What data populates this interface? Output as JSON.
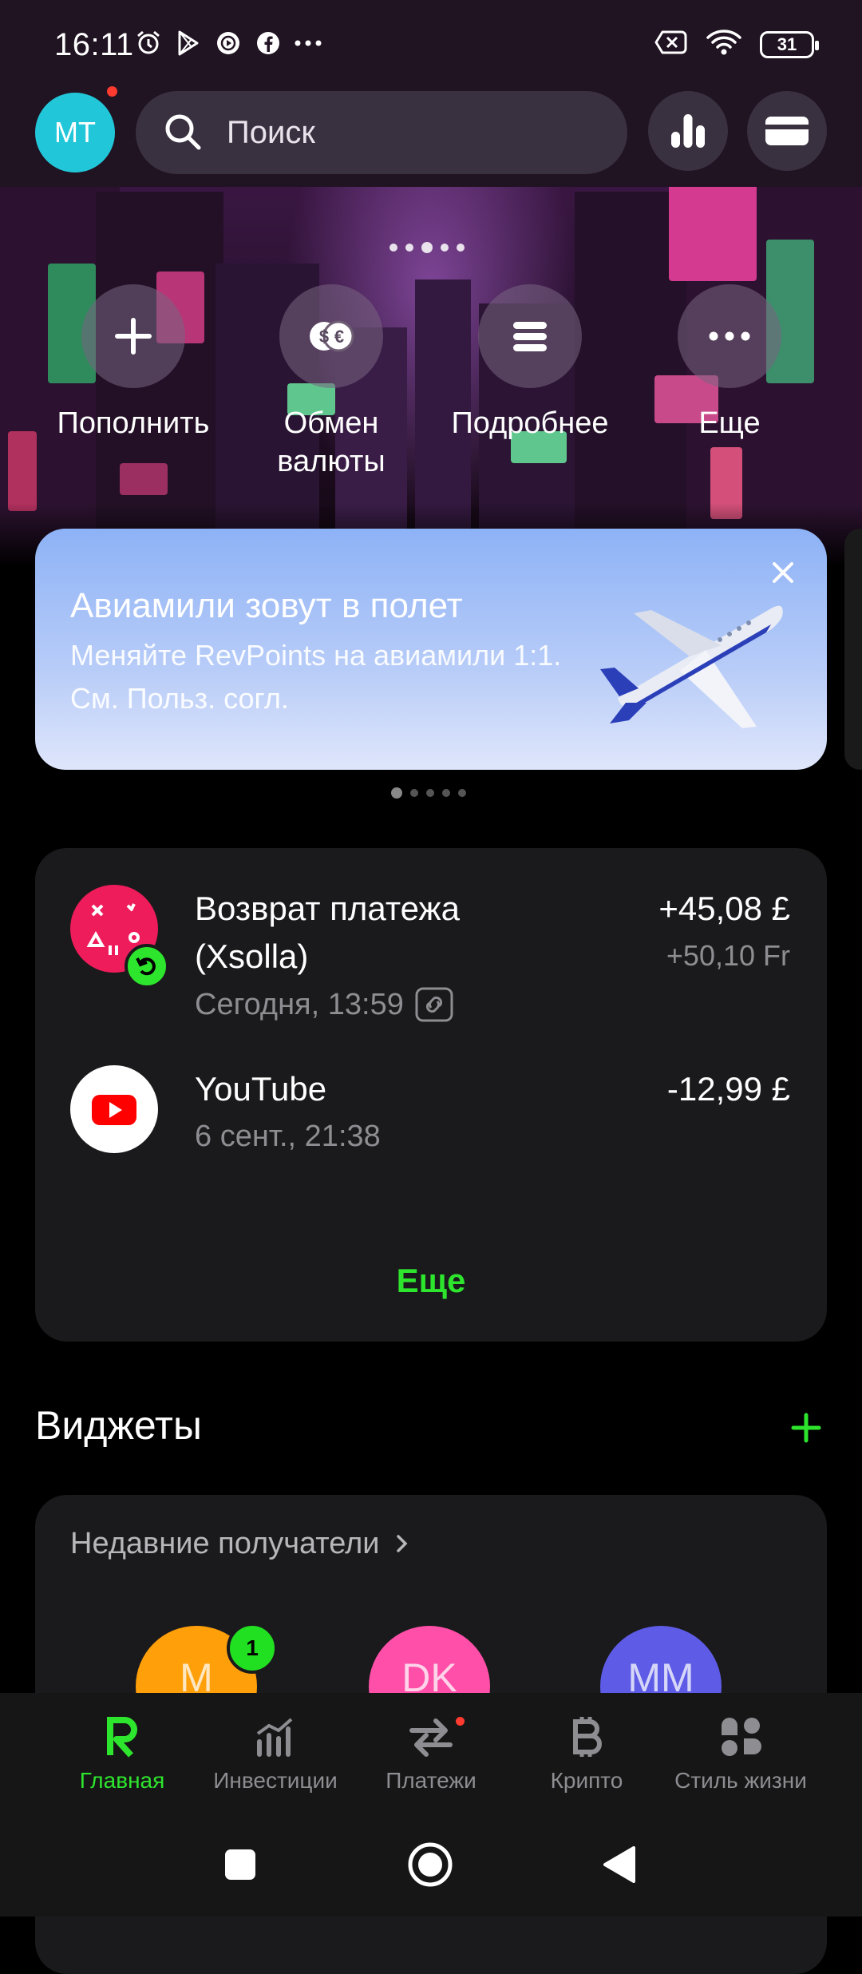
{
  "status_bar": {
    "time": "16:11",
    "battery": "31"
  },
  "header": {
    "avatar_initials": "MT",
    "search_placeholder": "Поиск"
  },
  "actions": [
    {
      "label": "Пополнить"
    },
    {
      "label": "Обмен валюты"
    },
    {
      "label": "Подробнее"
    },
    {
      "label": "Еще"
    }
  ],
  "promo": {
    "title": "Авиамили зовут в полет",
    "subtitle": "Меняйте RevPoints на авиамили 1:1. См. Польз. согл."
  },
  "transactions": [
    {
      "name": "Возврат платежа (Xsolla)",
      "date": "Сегодня, 13:59",
      "amount": "+45,08 £",
      "amount_secondary": "+50,10 Fr"
    },
    {
      "name": "YouTube",
      "date": "6 сент., 21:38",
      "amount": "-12,99 £"
    }
  ],
  "transactions_more": "Еще",
  "widgets": {
    "title": "Виджеты",
    "recent_title": "Недавние получатели",
    "recipients": [
      {
        "initials": "M",
        "badge": "1",
        "color": "#ff9f0a"
      },
      {
        "initials": "DK",
        "color": "#ff4fa8"
      },
      {
        "initials": "MM",
        "color": "#5e5ce6"
      }
    ]
  },
  "tabs": [
    {
      "label": "Главная",
      "active": true
    },
    {
      "label": "Инвестиции"
    },
    {
      "label": "Платежи"
    },
    {
      "label": "Крипто"
    },
    {
      "label": "Стиль жизни"
    }
  ],
  "colors": {
    "accent": "#2ee52e",
    "avatar": "#21c7d9",
    "card": "#1a1a1c"
  }
}
